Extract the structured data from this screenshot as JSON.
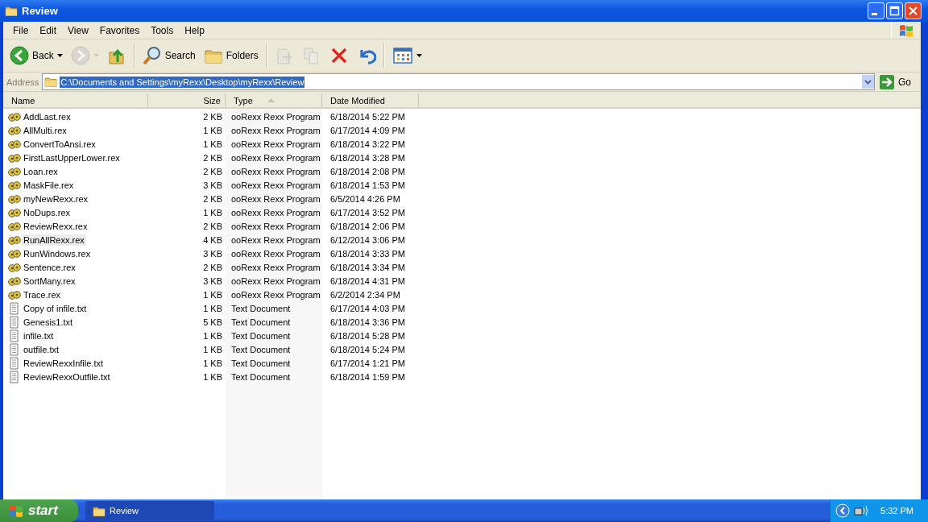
{
  "window": {
    "title": "Review"
  },
  "menu": [
    "File",
    "Edit",
    "View",
    "Favorites",
    "Tools",
    "Help"
  ],
  "toolbar": [
    {
      "kind": "back",
      "label": "Back",
      "disabled": false,
      "dropdown": true
    },
    {
      "kind": "forward",
      "disabled": true,
      "dropdown": true
    },
    {
      "kind": "up",
      "disabled": false,
      "dropdown": false
    },
    {
      "kind": "search",
      "label": "Search",
      "disabled": false,
      "dropdown": false
    },
    {
      "kind": "folders",
      "label": "Folders",
      "disabled": false,
      "dropdown": false
    },
    {
      "kind": "move",
      "disabled": true,
      "dropdown": false
    },
    {
      "kind": "copy",
      "disabled": true,
      "dropdown": false
    },
    {
      "kind": "delete",
      "disabled": false,
      "dropdown": false
    },
    {
      "kind": "undo",
      "disabled": false,
      "dropdown": false
    },
    {
      "kind": "views",
      "disabled": false,
      "dropdown": true
    }
  ],
  "address": {
    "label": "Address",
    "value": "C:\\Documents and Settings\\myRexx\\Desktop\\myRexx\\Review",
    "selected": true,
    "go": "Go"
  },
  "table": {
    "columns": [
      {
        "label": "Name",
        "sorted": false
      },
      {
        "label": "Size",
        "sorted": false
      },
      {
        "label": "Type",
        "sorted": true
      },
      {
        "label": "Date Modified",
        "sorted": false
      }
    ],
    "rows": [
      {
        "kind": "rex",
        "name": "AddLast.rex",
        "size": "2 KB",
        "type": "ooRexx Rexx Program",
        "date": "6/18/2014 5:22 PM",
        "hovered": false
      },
      {
        "kind": "rex",
        "name": "AllMulti.rex",
        "size": "1 KB",
        "type": "ooRexx Rexx Program",
        "date": "6/17/2014 4:09 PM",
        "hovered": false
      },
      {
        "kind": "rex",
        "name": "ConvertToAnsi.rex",
        "size": "1 KB",
        "type": "ooRexx Rexx Program",
        "date": "6/18/2014 3:22 PM",
        "hovered": false
      },
      {
        "kind": "rex",
        "name": "FirstLastUpperLower.rex",
        "size": "2 KB",
        "type": "ooRexx Rexx Program",
        "date": "6/18/2014 3:28 PM",
        "hovered": false
      },
      {
        "kind": "rex",
        "name": "Loan.rex",
        "size": "2 KB",
        "type": "ooRexx Rexx Program",
        "date": "6/18/2014 2:08 PM",
        "hovered": false
      },
      {
        "kind": "rex",
        "name": "MaskFile.rex",
        "size": "3 KB",
        "type": "ooRexx Rexx Program",
        "date": "6/18/2014 1:53 PM",
        "hovered": false
      },
      {
        "kind": "rex",
        "name": "myNewRexx.rex",
        "size": "2 KB",
        "type": "ooRexx Rexx Program",
        "date": "6/5/2014 4:26 PM",
        "hovered": false
      },
      {
        "kind": "rex",
        "name": "NoDups.rex",
        "size": "1 KB",
        "type": "ooRexx Rexx Program",
        "date": "6/17/2014 3:52 PM",
        "hovered": false
      },
      {
        "kind": "rex",
        "name": "ReviewRexx.rex",
        "size": "2 KB",
        "type": "ooRexx Rexx Program",
        "date": "6/18/2014 2:06 PM",
        "hovered": false
      },
      {
        "kind": "rex",
        "name": "RunAllRexx.rex",
        "size": "4 KB",
        "type": "ooRexx Rexx Program",
        "date": "6/12/2014 3:06 PM",
        "hovered": true
      },
      {
        "kind": "rex",
        "name": "RunWindows.rex",
        "size": "3 KB",
        "type": "ooRexx Rexx Program",
        "date": "6/18/2014 3:33 PM",
        "hovered": false
      },
      {
        "kind": "rex",
        "name": "Sentence.rex",
        "size": "2 KB",
        "type": "ooRexx Rexx Program",
        "date": "6/18/2014 3:34 PM",
        "hovered": false
      },
      {
        "kind": "rex",
        "name": "SortMany.rex",
        "size": "3 KB",
        "type": "ooRexx Rexx Program",
        "date": "6/18/2014 4:31 PM",
        "hovered": false
      },
      {
        "kind": "rex",
        "name": "Trace.rex",
        "size": "1 KB",
        "type": "ooRexx Rexx Program",
        "date": "6/2/2014 2:34 PM",
        "hovered": false
      },
      {
        "kind": "txt",
        "name": "Copy of infile.txt",
        "size": "1 KB",
        "type": "Text Document",
        "date": "6/17/2014 4:03 PM",
        "hovered": false
      },
      {
        "kind": "txt",
        "name": "Genesis1.txt",
        "size": "5 KB",
        "type": "Text Document",
        "date": "6/18/2014 3:36 PM",
        "hovered": false
      },
      {
        "kind": "txt",
        "name": "infile.txt",
        "size": "1 KB",
        "type": "Text Document",
        "date": "6/18/2014 5:28 PM",
        "hovered": false
      },
      {
        "kind": "txt",
        "name": "outfile.txt",
        "size": "1 KB",
        "type": "Text Document",
        "date": "6/18/2014 5:24 PM",
        "hovered": false
      },
      {
        "kind": "txt",
        "name": "ReviewRexxInfile.txt",
        "size": "1 KB",
        "type": "Text Document",
        "date": "6/17/2014 1:21 PM",
        "hovered": false
      },
      {
        "kind": "txt",
        "name": "ReviewRexxOutfile.txt",
        "size": "1 KB",
        "type": "Text Document",
        "date": "6/18/2014 1:59 PM",
        "hovered": false
      }
    ]
  },
  "taskbar": {
    "start": "start",
    "tasks": [
      {
        "label": "Review",
        "selected": true
      }
    ],
    "clock": "5:32 PM"
  }
}
